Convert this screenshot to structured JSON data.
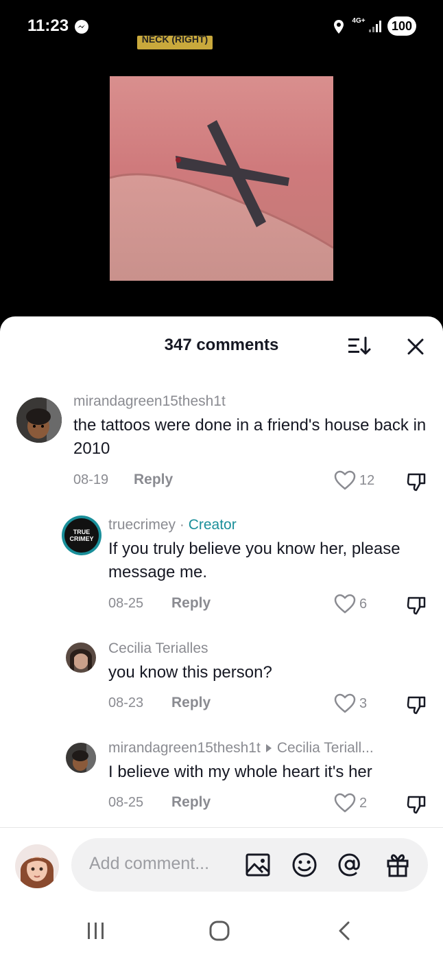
{
  "status_bar": {
    "time": "11:23",
    "network": "4G+",
    "battery": "100"
  },
  "video": {
    "overlay_label": "NECK (RIGHT)"
  },
  "comments_sheet": {
    "title": "347 comments",
    "comments": [
      {
        "username": "mirandagreen15thesh1t",
        "text": "the tattoos were done in a friend's house back in 2010",
        "date": "08-19",
        "reply_label": "Reply",
        "likes": "12"
      },
      {
        "username": "truecrimey",
        "separator": " · ",
        "tag": "Creator",
        "text": "If you truly believe you know her, please message me.",
        "date": "08-25",
        "reply_label": "Reply",
        "likes": "6",
        "avatar_text_line1": "TRUE",
        "avatar_text_line2": "CRIMEY"
      },
      {
        "username": "Cecilia Terialles",
        "text": "you know this person?",
        "date": "08-23",
        "reply_label": "Reply",
        "likes": "3"
      },
      {
        "username": "mirandagreen15thesh1t",
        "reply_to": "Cecilia Teriall...",
        "text": "I believe with my whole heart it's her",
        "date": "08-25",
        "reply_label": "Reply",
        "likes": "2"
      }
    ]
  },
  "input": {
    "placeholder": "Add comment..."
  },
  "colors": {
    "creator_accent": "#1a8f9a",
    "battery_bg": "#ffffff",
    "label_bg": "#c9a93c"
  }
}
